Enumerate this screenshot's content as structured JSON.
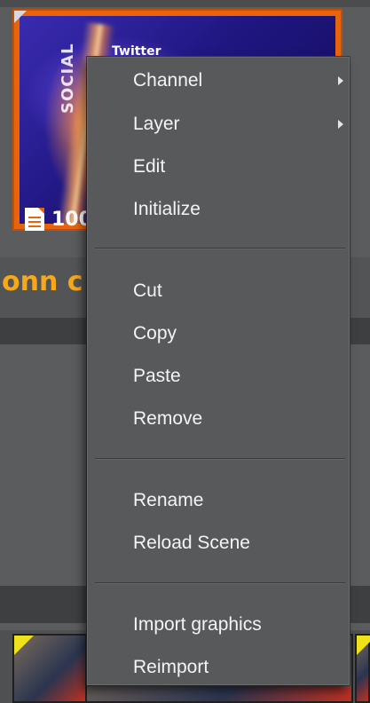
{
  "background": {
    "thumbnail": {
      "twitter_text": "Twitter",
      "social_text": "SOCIAL",
      "percent_text": "100",
      "accent_color": "#e8640c"
    },
    "scene_title": "onn c",
    "scene_title_color": "#f5a81a"
  },
  "context_menu": {
    "groups": [
      {
        "items": [
          {
            "label": "Channel",
            "submenu": true
          },
          {
            "label": "Layer",
            "submenu": true
          },
          {
            "label": "Edit",
            "submenu": false
          },
          {
            "label": "Initialize",
            "submenu": false
          }
        ]
      },
      {
        "items": [
          {
            "label": "Cut",
            "submenu": false
          },
          {
            "label": "Copy",
            "submenu": false
          },
          {
            "label": "Paste",
            "submenu": false
          },
          {
            "label": "Remove",
            "submenu": false
          }
        ]
      },
      {
        "items": [
          {
            "label": "Rename",
            "submenu": false
          },
          {
            "label": "Reload Scene",
            "submenu": false
          }
        ]
      },
      {
        "items": [
          {
            "label": "Import graphics",
            "submenu": false
          },
          {
            "label": "Reimport",
            "submenu": false
          }
        ]
      }
    ]
  }
}
